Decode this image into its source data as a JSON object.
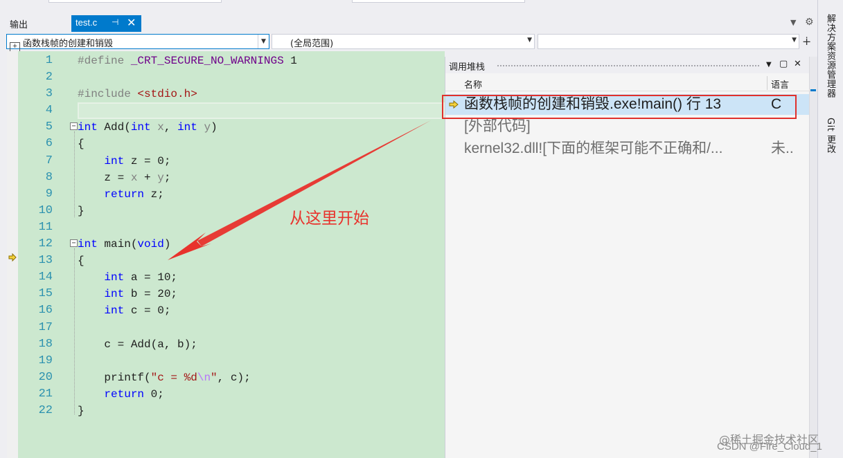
{
  "tabs": {
    "output_label": "输出",
    "active_file": "test.c",
    "pin_icon": "⊣",
    "close_icon": "✕"
  },
  "navbar": {
    "project_dropdown": "函数栈帧的创建和销毁",
    "scope_dropdown": "(全局范围)",
    "member_dropdown": ""
  },
  "editor": {
    "line_numbers": [
      "1",
      "2",
      "3",
      "4",
      "5",
      "6",
      "7",
      "8",
      "9",
      "10",
      "11",
      "12",
      "13",
      "14",
      "15",
      "16",
      "17",
      "18",
      "19",
      "20",
      "21",
      "22"
    ],
    "current_line": "13"
  },
  "annotation": {
    "text": "从这里开始"
  },
  "call_stack": {
    "title": "调用堆栈",
    "col_name": "名称",
    "col_lang": "语言",
    "rows": [
      {
        "name": "函数栈帧的创建和销毁.exe!main() 行 13",
        "lang": "C"
      },
      {
        "name": "[外部代码]",
        "lang": ""
      },
      {
        "name": "kernel32.dll![下面的框架可能不正确和/...",
        "lang": "未.."
      }
    ]
  },
  "rail": {
    "solution_explorer": "解决方案资源管理器",
    "git_changes": "Git 更改"
  },
  "watermark": {
    "line1": "@稀土掘金技术社区",
    "line2": "CSDN @Fire_Cloud_1"
  },
  "colors": {
    "accent": "#007acc",
    "editor_bg": "#cce8cf",
    "annotation_red": "#e8322c",
    "keyword": "#0000ff"
  }
}
